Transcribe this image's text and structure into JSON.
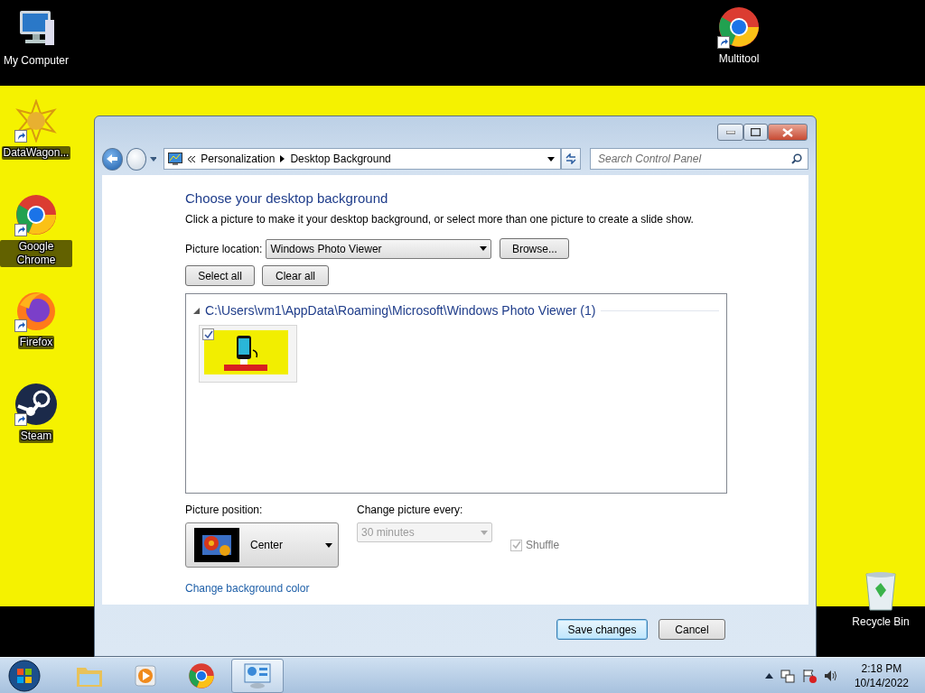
{
  "desktop_icons": [
    {
      "label": "My Computer",
      "kind": "computer",
      "shortcut": false
    },
    {
      "label": "DataWagon...",
      "kind": "star",
      "shortcut": true
    },
    {
      "label": "Google Chrome",
      "kind": "chrome",
      "shortcut": true
    },
    {
      "label": "Firefox",
      "kind": "firefox",
      "shortcut": true
    },
    {
      "label": "Steam",
      "kind": "steam",
      "shortcut": true
    },
    {
      "label": "Multitool",
      "kind": "chrome",
      "shortcut": true
    },
    {
      "label": "Recycle Bin",
      "kind": "bin",
      "shortcut": false
    }
  ],
  "window": {
    "breadcrumb": [
      "Personalization",
      "Desktop Background"
    ],
    "search": {
      "placeholder": "Search Control Panel"
    },
    "heading": "Choose your desktop background",
    "description": "Click a picture to make it your desktop background, or select more than one picture to create a slide show.",
    "location": {
      "label": "Picture location:",
      "value": "Windows Photo Viewer",
      "browse": "Browse..."
    },
    "selection_buttons": [
      "Select all",
      "Clear all"
    ],
    "group": {
      "path": "C:\\Users\\vm1\\AppData\\Roaming\\Microsoft\\Windows Photo Viewer (1)",
      "expanded": true,
      "pictures": [
        {
          "kind": "picture",
          "checked": true
        }
      ]
    },
    "position": {
      "label": "Picture position:",
      "value": "Center"
    },
    "interval": {
      "label": "Change picture every:",
      "value": "30 minutes",
      "disabled": true
    },
    "shuffle": {
      "label": "Shuffle",
      "checked": true,
      "disabled": true
    },
    "color_link": "Change background color",
    "buttons": [
      {
        "label": "Save changes",
        "default": true
      },
      {
        "label": "Cancel",
        "default": false
      }
    ]
  },
  "taskbar": {
    "items": [
      {
        "kind": "explorer",
        "active": false
      },
      {
        "kind": "media",
        "active": false
      },
      {
        "kind": "chrome",
        "active": false
      },
      {
        "kind": "control",
        "active": true
      }
    ],
    "time": "2:18 PM",
    "date": "10/14/2022"
  }
}
